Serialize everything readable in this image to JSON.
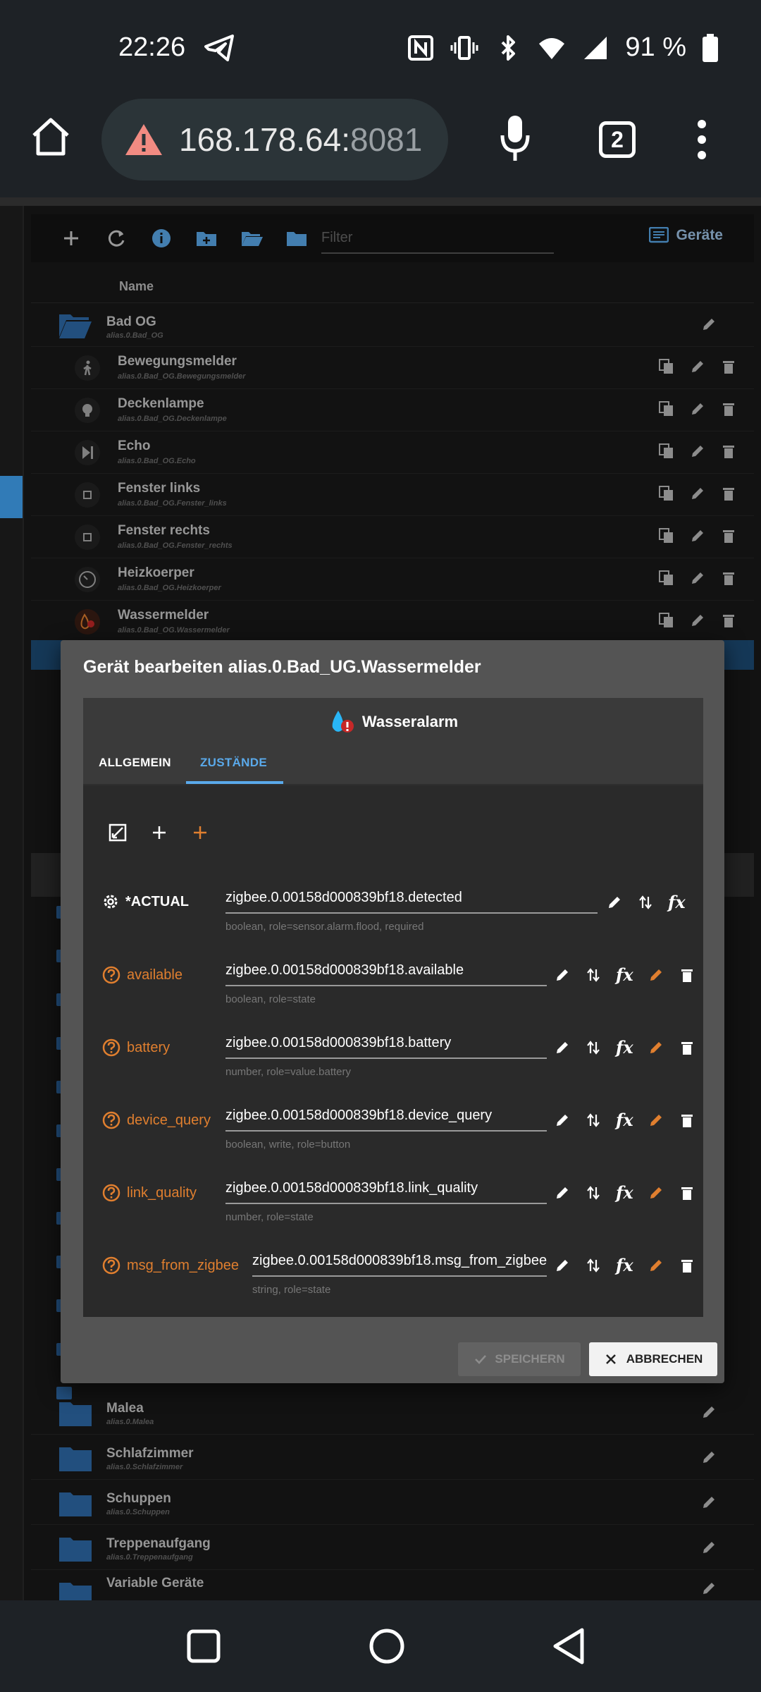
{
  "status": {
    "time": "22:26",
    "battery": "91 %"
  },
  "browser": {
    "url_host": "168.178.64:",
    "url_port": "8081",
    "tab_count": "2"
  },
  "toolbar": {
    "filter_placeholder": "Filter",
    "devices_label": "Geräte"
  },
  "list": {
    "header_name": "Name",
    "folder_top": {
      "title": "Bad OG",
      "sub": "alias.0.Bad_OG"
    },
    "devices": [
      {
        "title": "Bewegungsmelder",
        "sub": "alias.0.Bad_OG.Bewegungsmelder"
      },
      {
        "title": "Deckenlampe",
        "sub": "alias.0.Bad_OG.Deckenlampe"
      },
      {
        "title": "Echo",
        "sub": "alias.0.Bad_OG.Echo"
      },
      {
        "title": "Fenster links",
        "sub": "alias.0.Bad_OG.Fenster_links"
      },
      {
        "title": "Fenster rechts",
        "sub": "alias.0.Bad_OG.Fenster_rechts"
      },
      {
        "title": "Heizkoerper",
        "sub": "alias.0.Bad_OG.Heizkoerper"
      },
      {
        "title": "Wassermelder",
        "sub": "alias.0.Bad_OG.Wassermelder"
      }
    ],
    "folders_bottom": [
      {
        "title": "Malea",
        "sub": "alias.0.Malea"
      },
      {
        "title": "Schlafzimmer",
        "sub": "alias.0.Schlafzimmer"
      },
      {
        "title": "Schuppen",
        "sub": "alias.0.Schuppen"
      },
      {
        "title": "Treppenaufgang",
        "sub": "alias.0.Treppenaufgang"
      },
      {
        "title": "Variable Geräte",
        "sub": ""
      }
    ]
  },
  "dialog": {
    "title": "Gerät bearbeiten alias.0.Bad_UG.Wassermelder",
    "device_name": "Wasseralarm",
    "tab_general": "ALLGEMEIN",
    "tab_states": "ZUSTÄNDE",
    "states": [
      {
        "label": "*ACTUAL",
        "value": "zigbee.0.00158d000839bf18.detected",
        "meta": "boolean, role=sensor.alarm.flood, required"
      },
      {
        "label": "available",
        "value": "zigbee.0.00158d000839bf18.available",
        "meta": "boolean, role=state"
      },
      {
        "label": "battery",
        "value": "zigbee.0.00158d000839bf18.battery",
        "meta": "number, role=value.battery"
      },
      {
        "label": "device_query",
        "value": "zigbee.0.00158d000839bf18.device_query",
        "meta": "boolean, write, role=button"
      },
      {
        "label": "link_quality",
        "value": "zigbee.0.00158d000839bf18.link_quality",
        "meta": "number, role=state"
      },
      {
        "label": "msg_from_zigbee",
        "value": "zigbee.0.00158d000839bf18.msg_from_zigbee",
        "meta": "string, role=state"
      }
    ],
    "save_label": "SPEICHERN",
    "cancel_label": "ABBRECHEN"
  },
  "colors": {
    "accent_blue": "#5aa9ea",
    "state_orange": "#e07f2f",
    "folder_blue": "#2e6aa8"
  }
}
